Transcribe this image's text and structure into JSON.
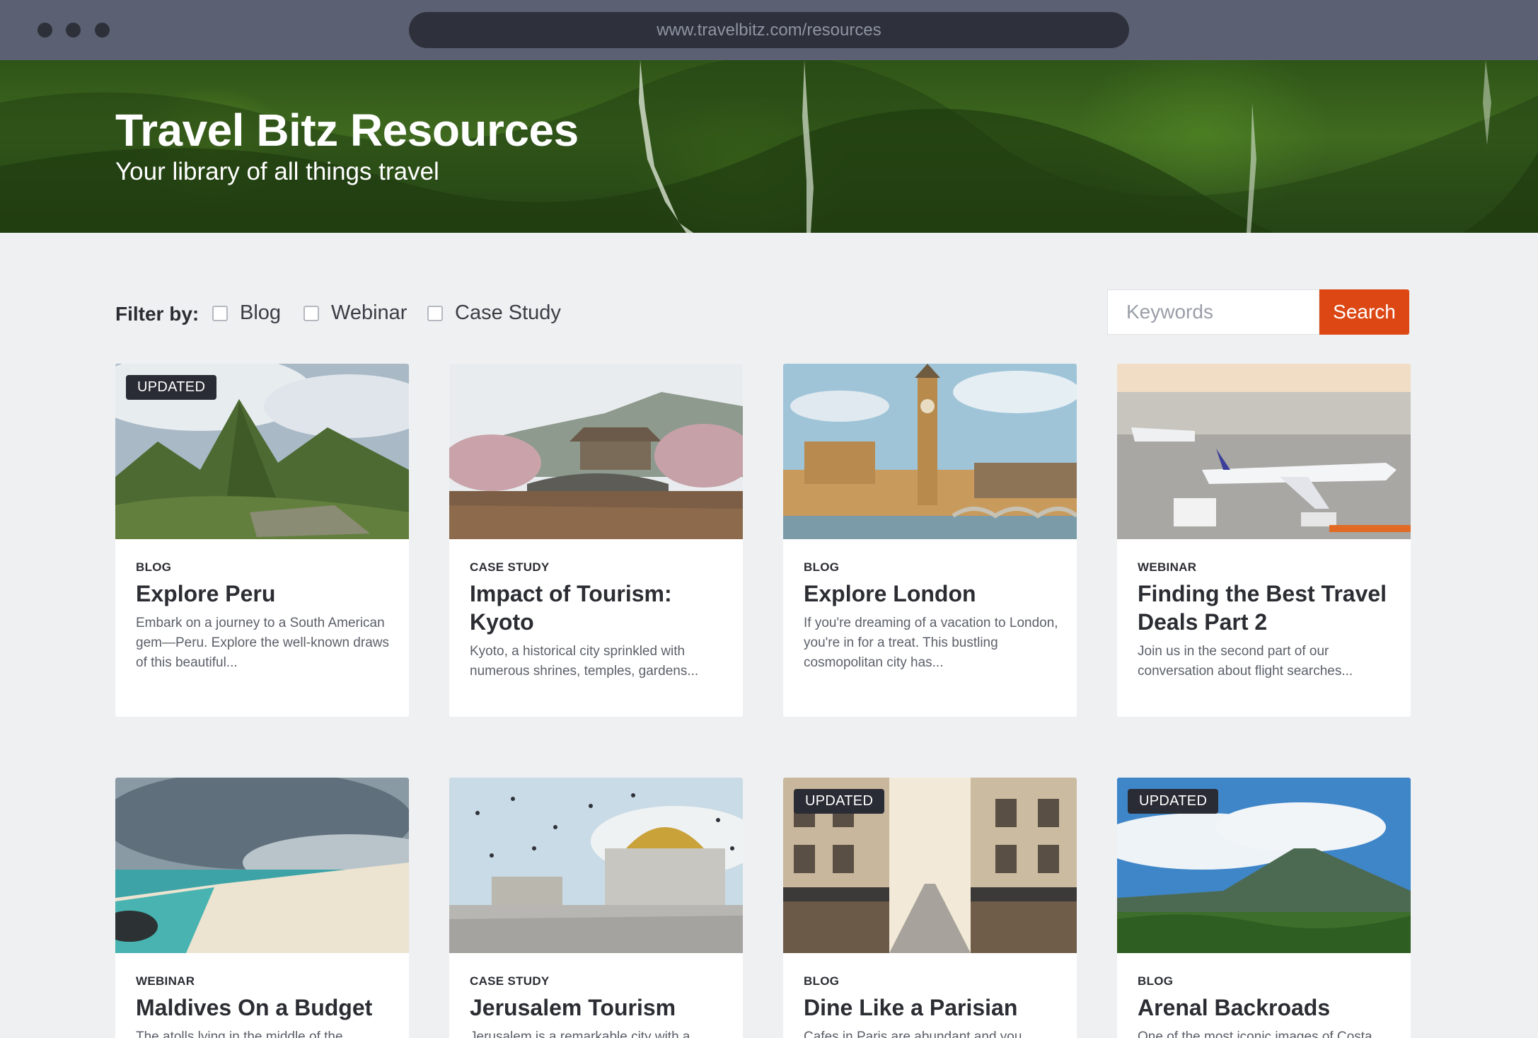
{
  "browser": {
    "url": "www.travelbitz.com/resources"
  },
  "hero": {
    "title": "Travel Bitz Resources",
    "subtitle": "Your library of all things travel"
  },
  "filter": {
    "label": "Filter by:",
    "options": [
      {
        "label": "Blog",
        "checked": false
      },
      {
        "label": "Webinar",
        "checked": false
      },
      {
        "label": "Case Study",
        "checked": false
      }
    ]
  },
  "search": {
    "placeholder": "Keywords",
    "button_label": "Search"
  },
  "cards": [
    {
      "badge": "UPDATED",
      "category": "BLOG",
      "title": "Explore Peru",
      "description": "Embark on a journey to a South American gem—Peru. Explore the well-known draws of this beautiful..."
    },
    {
      "badge": "",
      "category": "CASE STUDY",
      "title": "Impact of Tourism: Kyoto",
      "description": "Kyoto, a historical city sprinkled with numerous shrines, temples, gardens..."
    },
    {
      "badge": "",
      "category": "BLOG",
      "title": "Explore London",
      "description": "If you're dreaming of a vacation to London, you're in for a treat. This bustling cosmopolitan city has..."
    },
    {
      "badge": "",
      "category": "WEBINAR",
      "title": "Finding the Best Travel Deals Part 2",
      "description": "Join us in the second part of our conversation about flight searches..."
    },
    {
      "badge": "",
      "category": "WEBINAR",
      "title": "Maldives On a Budget",
      "description": "The atolls lying in the middle of the"
    },
    {
      "badge": "",
      "category": "CASE STUDY",
      "title": "Jerusalem Tourism",
      "description": "Jerusalem is a remarkable city with a"
    },
    {
      "badge": "UPDATED",
      "category": "BLOG",
      "title": "Dine Like a Parisian",
      "description": "Cafes in Paris are abundant and you"
    },
    {
      "badge": "UPDATED",
      "category": "BLOG",
      "title": "Arenal Backroads",
      "description": "One of the most iconic images of Costa"
    }
  ],
  "colors": {
    "accent": "#dc4714",
    "chrome": "#5b6072",
    "page_bg": "#eff0f2",
    "badge_bg": "#2a2c35"
  }
}
